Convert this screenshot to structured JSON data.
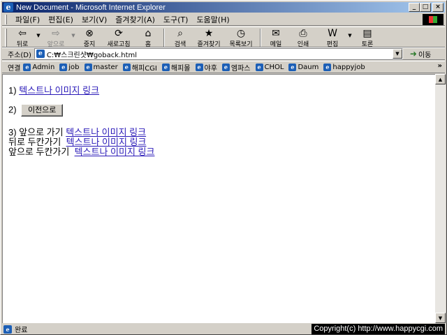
{
  "window": {
    "title": "New Document - Microsoft Internet Explorer",
    "minimize_label": "_",
    "maximize_label": "□",
    "close_label": "×"
  },
  "menu": [
    "파일(F)",
    "편집(E)",
    "보기(V)",
    "즐겨찾기(A)",
    "도구(T)",
    "도움말(H)"
  ],
  "toolbar": {
    "back": {
      "label": "뒤로",
      "icon": "back-arrow-icon"
    },
    "forward": {
      "label": "앞으로",
      "icon": "forward-arrow-icon"
    },
    "stop": {
      "label": "중지",
      "icon": "stop-icon"
    },
    "refresh": {
      "label": "새로고침",
      "icon": "refresh-icon"
    },
    "home": {
      "label": "홈",
      "icon": "home-icon"
    },
    "search": {
      "label": "검색",
      "icon": "search-icon"
    },
    "favorites": {
      "label": "즐겨찾기",
      "icon": "favorites-icon"
    },
    "history": {
      "label": "목록보기",
      "icon": "history-icon"
    },
    "mail": {
      "label": "메일",
      "icon": "mail-icon"
    },
    "print": {
      "label": "인쇄",
      "icon": "print-icon"
    },
    "edit": {
      "label": "편집",
      "icon": "edit-icon"
    },
    "discuss": {
      "label": "토론",
      "icon": "discuss-icon"
    }
  },
  "address": {
    "label": "주소(D)",
    "value": "C:₩스크린샷₩goback.html",
    "go_label": "이동"
  },
  "links": {
    "label": "연결",
    "items": [
      "Admin",
      "job",
      "master",
      "해피CGI",
      "해피몰",
      "야후",
      "엠파스",
      "CHOL",
      "Daum",
      "happyjob"
    ]
  },
  "content": {
    "line1_prefix": "1)",
    "line1_link": "텍스트나 이미지 링크",
    "line2_prefix": "2)",
    "line2_button": "이전으로",
    "line3_prefix": "3) 앞으로 가기",
    "line3_link": "텍스트나 이미지 링크",
    "line4_prefix": "뒤로 두칸가기",
    "line4_link": "텍스트나 이미지 링크",
    "line5_prefix": "앞으로 두칸가기",
    "line5_link": "텍스트나 이미지 링크"
  },
  "status": {
    "text": "완료",
    "copyright": "Copyright(c) http://www.happycgi.com"
  }
}
